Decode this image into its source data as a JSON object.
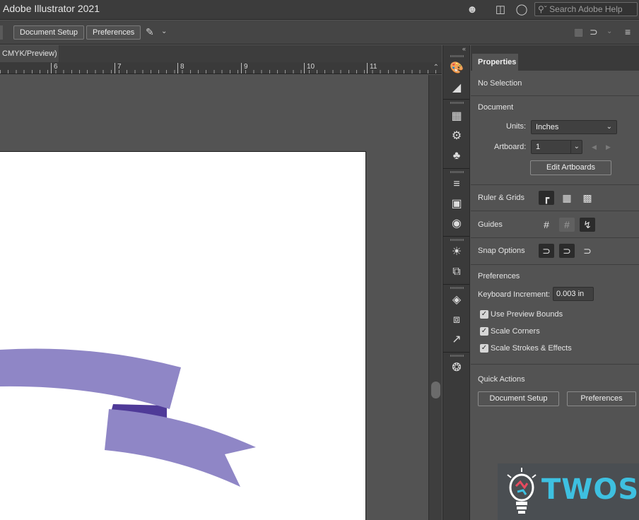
{
  "window": {
    "title": "Adobe Illustrator 2021"
  },
  "titlebar": {
    "search_placeholder": "Search Adobe Help"
  },
  "controlbar": {
    "document_setup_label": "Document Setup",
    "preferences_label": "Preferences"
  },
  "document": {
    "tab_label": "CMYK/Preview)"
  },
  "ruler": {
    "marks": [
      "6",
      "7",
      "8",
      "9",
      "10",
      "11"
    ]
  },
  "artwork": {
    "ribbon_color": "#8f86c6",
    "fold_color": "#4f3a98"
  },
  "properties": {
    "tab_label": "Properties",
    "selection_status": "No Selection",
    "document_heading": "Document",
    "units_label": "Units:",
    "units_value": "Inches",
    "artboard_label": "Artboard:",
    "artboard_value": "1",
    "edit_artboards_label": "Edit Artboards",
    "ruler_grids_label": "Ruler & Grids",
    "guides_label": "Guides",
    "snap_options_label": "Snap Options",
    "preferences_heading": "Preferences",
    "keyboard_increment_label": "Keyboard Increment:",
    "keyboard_increment_value": "0.003 in",
    "checkboxes": [
      {
        "label": "Use Preview Bounds",
        "checked": true
      },
      {
        "label": "Scale Corners",
        "checked": true
      },
      {
        "label": "Scale Strokes & Effects",
        "checked": true
      }
    ],
    "quick_actions_heading": "Quick Actions",
    "quick_document_setup_label": "Document Setup",
    "quick_preferences_label": "Preferences"
  },
  "watermark": {
    "text": "TWOS"
  },
  "icons": {
    "user": "user-icon",
    "panel_layout": "panel-layout-icon",
    "lightbulb": "lightbulb-icon",
    "search": "search-icon"
  }
}
